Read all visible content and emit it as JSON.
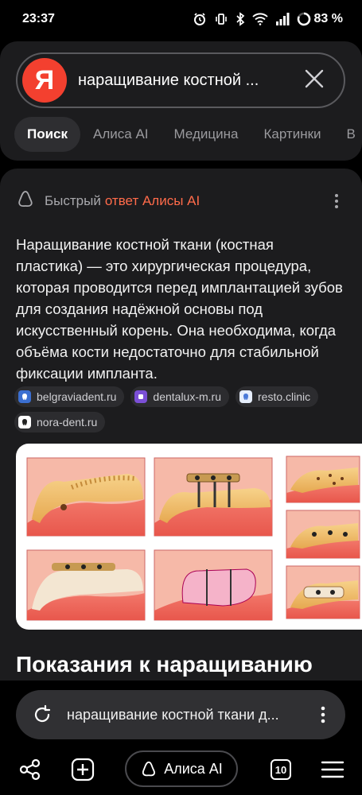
{
  "status_bar": {
    "time": "23:37",
    "battery": "83 %",
    "icons": [
      "alarm-icon",
      "vibrate-icon",
      "bluetooth-icon",
      "wifi-icon",
      "signal-icon",
      "battery-ring-icon"
    ]
  },
  "search": {
    "logo_letter": "Я",
    "query": "наращивание костной ...",
    "clear_icon": "close-icon"
  },
  "tabs": [
    {
      "label": "Поиск",
      "active": true
    },
    {
      "label": "Алиса AI",
      "active": false
    },
    {
      "label": "Медицина",
      "active": false
    },
    {
      "label": "Картинки",
      "active": false
    },
    {
      "label": "В",
      "active": false
    }
  ],
  "answer": {
    "header_prefix": "Быстрый",
    "header_highlight": "ответ Алисы AI",
    "text": "Наращивание костной ткани (костная пластика) — это хирургическая процедура, которая проводится перед имплантацией зубов для создания надёжной основы под искусственный корень. Она необходима, когда объёма кости недостаточно для стабильной фиксации импланта.",
    "sources": [
      {
        "label": "belgraviadent.ru",
        "icon_color": "#3b6fd1"
      },
      {
        "label": "dentalux-m.ru",
        "icon_color": "#7b4fd6"
      },
      {
        "label": "resto.clinic",
        "icon_color": "#e6eefc"
      },
      {
        "label": "nora-dent.ru",
        "icon_color": "#ffffff"
      }
    ]
  },
  "section_title": "Показания к наращиванию",
  "bottom_search": {
    "query": "наращивание костной ткани д..."
  },
  "nav": {
    "alice_label": "Алиса AI",
    "tab_count": "10"
  },
  "colors": {
    "accent_red": "#f3402f",
    "alice_orange": "#ff6b4a",
    "surface": "#1c1c1e",
    "background": "#000000"
  }
}
